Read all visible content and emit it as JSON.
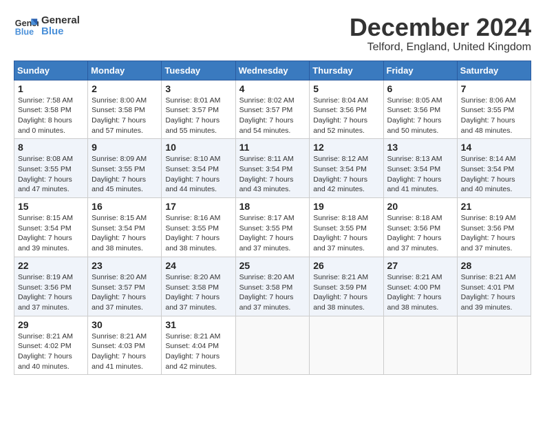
{
  "logo": {
    "line1": "General",
    "line2": "Blue"
  },
  "title": "December 2024",
  "subtitle": "Telford, England, United Kingdom",
  "days_of_week": [
    "Sunday",
    "Monday",
    "Tuesday",
    "Wednesday",
    "Thursday",
    "Friday",
    "Saturday"
  ],
  "weeks": [
    [
      {
        "day": "1",
        "info": "Sunrise: 7:58 AM\nSunset: 3:58 PM\nDaylight: 8 hours\nand 0 minutes."
      },
      {
        "day": "2",
        "info": "Sunrise: 8:00 AM\nSunset: 3:58 PM\nDaylight: 7 hours\nand 57 minutes."
      },
      {
        "day": "3",
        "info": "Sunrise: 8:01 AM\nSunset: 3:57 PM\nDaylight: 7 hours\nand 55 minutes."
      },
      {
        "day": "4",
        "info": "Sunrise: 8:02 AM\nSunset: 3:57 PM\nDaylight: 7 hours\nand 54 minutes."
      },
      {
        "day": "5",
        "info": "Sunrise: 8:04 AM\nSunset: 3:56 PM\nDaylight: 7 hours\nand 52 minutes."
      },
      {
        "day": "6",
        "info": "Sunrise: 8:05 AM\nSunset: 3:56 PM\nDaylight: 7 hours\nand 50 minutes."
      },
      {
        "day": "7",
        "info": "Sunrise: 8:06 AM\nSunset: 3:55 PM\nDaylight: 7 hours\nand 48 minutes."
      }
    ],
    [
      {
        "day": "8",
        "info": "Sunrise: 8:08 AM\nSunset: 3:55 PM\nDaylight: 7 hours\nand 47 minutes."
      },
      {
        "day": "9",
        "info": "Sunrise: 8:09 AM\nSunset: 3:55 PM\nDaylight: 7 hours\nand 45 minutes."
      },
      {
        "day": "10",
        "info": "Sunrise: 8:10 AM\nSunset: 3:54 PM\nDaylight: 7 hours\nand 44 minutes."
      },
      {
        "day": "11",
        "info": "Sunrise: 8:11 AM\nSunset: 3:54 PM\nDaylight: 7 hours\nand 43 minutes."
      },
      {
        "day": "12",
        "info": "Sunrise: 8:12 AM\nSunset: 3:54 PM\nDaylight: 7 hours\nand 42 minutes."
      },
      {
        "day": "13",
        "info": "Sunrise: 8:13 AM\nSunset: 3:54 PM\nDaylight: 7 hours\nand 41 minutes."
      },
      {
        "day": "14",
        "info": "Sunrise: 8:14 AM\nSunset: 3:54 PM\nDaylight: 7 hours\nand 40 minutes."
      }
    ],
    [
      {
        "day": "15",
        "info": "Sunrise: 8:15 AM\nSunset: 3:54 PM\nDaylight: 7 hours\nand 39 minutes."
      },
      {
        "day": "16",
        "info": "Sunrise: 8:15 AM\nSunset: 3:54 PM\nDaylight: 7 hours\nand 38 minutes."
      },
      {
        "day": "17",
        "info": "Sunrise: 8:16 AM\nSunset: 3:55 PM\nDaylight: 7 hours\nand 38 minutes."
      },
      {
        "day": "18",
        "info": "Sunrise: 8:17 AM\nSunset: 3:55 PM\nDaylight: 7 hours\nand 37 minutes."
      },
      {
        "day": "19",
        "info": "Sunrise: 8:18 AM\nSunset: 3:55 PM\nDaylight: 7 hours\nand 37 minutes."
      },
      {
        "day": "20",
        "info": "Sunrise: 8:18 AM\nSunset: 3:56 PM\nDaylight: 7 hours\nand 37 minutes."
      },
      {
        "day": "21",
        "info": "Sunrise: 8:19 AM\nSunset: 3:56 PM\nDaylight: 7 hours\nand 37 minutes."
      }
    ],
    [
      {
        "day": "22",
        "info": "Sunrise: 8:19 AM\nSunset: 3:56 PM\nDaylight: 7 hours\nand 37 minutes."
      },
      {
        "day": "23",
        "info": "Sunrise: 8:20 AM\nSunset: 3:57 PM\nDaylight: 7 hours\nand 37 minutes."
      },
      {
        "day": "24",
        "info": "Sunrise: 8:20 AM\nSunset: 3:58 PM\nDaylight: 7 hours\nand 37 minutes."
      },
      {
        "day": "25",
        "info": "Sunrise: 8:20 AM\nSunset: 3:58 PM\nDaylight: 7 hours\nand 37 minutes."
      },
      {
        "day": "26",
        "info": "Sunrise: 8:21 AM\nSunset: 3:59 PM\nDaylight: 7 hours\nand 38 minutes."
      },
      {
        "day": "27",
        "info": "Sunrise: 8:21 AM\nSunset: 4:00 PM\nDaylight: 7 hours\nand 38 minutes."
      },
      {
        "day": "28",
        "info": "Sunrise: 8:21 AM\nSunset: 4:01 PM\nDaylight: 7 hours\nand 39 minutes."
      }
    ],
    [
      {
        "day": "29",
        "info": "Sunrise: 8:21 AM\nSunset: 4:02 PM\nDaylight: 7 hours\nand 40 minutes."
      },
      {
        "day": "30",
        "info": "Sunrise: 8:21 AM\nSunset: 4:03 PM\nDaylight: 7 hours\nand 41 minutes."
      },
      {
        "day": "31",
        "info": "Sunrise: 8:21 AM\nSunset: 4:04 PM\nDaylight: 7 hours\nand 42 minutes."
      },
      null,
      null,
      null,
      null
    ]
  ]
}
